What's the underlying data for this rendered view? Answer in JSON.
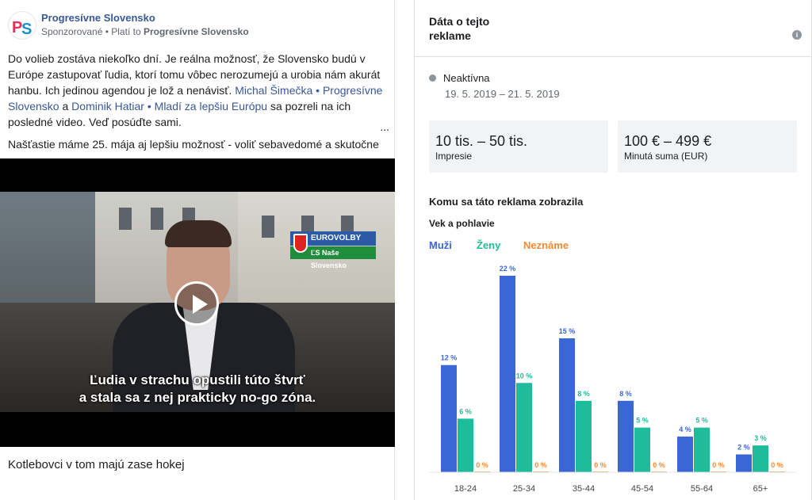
{
  "post": {
    "page_name": "Progresívne Slovensko",
    "sponsored": "Sponzorované",
    "paid_by_prefix": " • Platí to ",
    "paid_by": "Progresívne Slovensko",
    "text_1": "Do volieb zostáva niekoľko dní. Je reálna možnosť, že Slovensko budú v Európe zastupovať ľudia, ktorí tomu vôbec nerozumejú a urobia nám akurát hanbu. Ich jedinou agendou je lož a nenávisť. ",
    "link_1": "Michal Šimečka • Progresívne Slovensko",
    "text_2": " a ",
    "link_2": "Dominik Hatiar • Mladí za lepšiu Európu",
    "text_3": " sa pozreli na ich posledné video. Veď posúďte sami.",
    "ellipsis": "...",
    "line_2": "Našťastie máme 25. mája aj lepšiu možnosť - voliť sebavedomé a skutočne",
    "video": {
      "badge_top": "EUROVOLBY 2019",
      "badge_bottom": "ĽS Naše Slovensko",
      "subtitle_1": "Ľudia v strachu opustili túto štvrť",
      "subtitle_2": "a stala sa z nej prakticky no-go zóna."
    },
    "caption": "Kotlebovci v tom majú zase hokej"
  },
  "panel": {
    "title": "Dáta o tejto reklame",
    "info_icon": "i",
    "status": "Neaktívna",
    "dates": "19. 5. 2019 – 21. 5. 2019",
    "impressions_value": "10 tis. – 50 tis.",
    "impressions_label": "Impresie",
    "spend_value": "100 € – 499 €",
    "spend_label": "Minutá suma (EUR)",
    "audience_title": "Komu sa táto reklama zobrazila",
    "age_gender_title": "Vek a pohlavie",
    "legend": {
      "men": "Muži",
      "women": "Ženy",
      "unknown": "Neznáme"
    }
  },
  "colors": {
    "men": "#3b67d6",
    "women": "#1fbc9c",
    "unknown": "#f78a31",
    "link": "#385898"
  },
  "chart_data": {
    "type": "bar",
    "categories": [
      "18-24",
      "25-34",
      "35-44",
      "45-54",
      "55-64",
      "65+"
    ],
    "series": [
      {
        "name": "Muži",
        "values": [
          12,
          22,
          15,
          8,
          4,
          2
        ],
        "labels": [
          "12 %",
          "22 %",
          "15 %",
          "8 %",
          "4 %",
          "2 %"
        ]
      },
      {
        "name": "Ženy",
        "values": [
          6,
          10,
          8,
          5,
          5,
          3
        ],
        "labels": [
          "6 %",
          "10 %",
          "8 %",
          "5 %",
          "5 %",
          "3 %"
        ]
      },
      {
        "name": "Neznáme",
        "values": [
          0,
          0,
          0,
          0,
          0,
          0
        ],
        "labels": [
          "0 %",
          "0 %",
          "0 %",
          "0 %",
          "0 %",
          "0 %"
        ]
      }
    ],
    "ylim": [
      0,
      22
    ]
  }
}
